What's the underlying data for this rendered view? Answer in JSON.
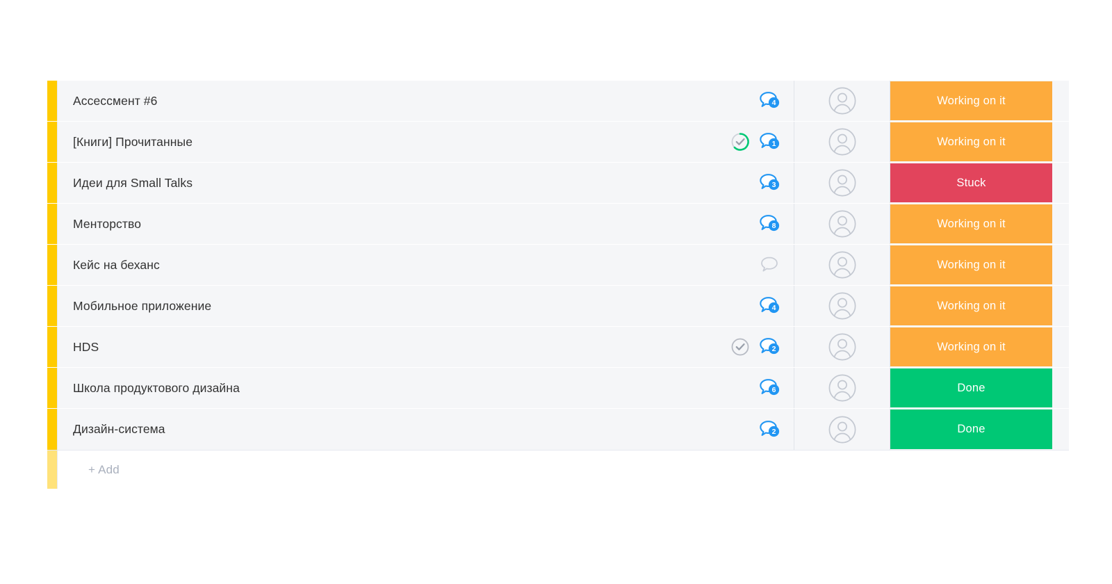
{
  "board": {
    "accent_color": "#ffcb00",
    "add_row": {
      "label": "+ Add",
      "bar_color": "#ffe27a"
    },
    "status_colors": {
      "working": "#fdab3d",
      "stuck": "#e2445c",
      "done": "#00c875"
    },
    "icon_colors": {
      "chat_blue": "#2196f3",
      "chat_empty_gray": "#c9cdd6",
      "check_green": "#00c875",
      "check_gray": "#9aa0ab",
      "avatar_gray": "#c3c8d1"
    },
    "rows": [
      {
        "name": "Ассессмент #6",
        "check": "none",
        "chat_icon": "chat-bubble-icon",
        "chat_count": "4",
        "person_icon": "avatar-placeholder-icon",
        "status": "Working on it",
        "status_key": "working"
      },
      {
        "name": "[Книги] Прочитанные",
        "check": "green",
        "check_icon": "check-circle-progress-icon",
        "chat_icon": "chat-bubble-icon",
        "chat_count": "1",
        "person_icon": "avatar-placeholder-icon",
        "status": "Working on it",
        "status_key": "working"
      },
      {
        "name": "Идеи для Small Talks",
        "check": "none",
        "chat_icon": "chat-bubble-icon",
        "chat_count": "3",
        "person_icon": "avatar-placeholder-icon",
        "status": "Stuck",
        "status_key": "stuck"
      },
      {
        "name": "Менторство",
        "check": "none",
        "chat_icon": "chat-bubble-icon",
        "chat_count": "8",
        "person_icon": "avatar-placeholder-icon",
        "status": "Working on it",
        "status_key": "working"
      },
      {
        "name": "Кейс на беханс",
        "check": "none",
        "chat_icon": "chat-bubble-empty-icon",
        "chat_count": "",
        "person_icon": "avatar-placeholder-icon",
        "status": "Working on it",
        "status_key": "working"
      },
      {
        "name": "Мобильное приложение",
        "check": "none",
        "chat_icon": "chat-bubble-icon",
        "chat_count": "4",
        "person_icon": "avatar-placeholder-icon",
        "status": "Working on it",
        "status_key": "working"
      },
      {
        "name": "HDS",
        "check": "gray",
        "check_icon": "check-circle-icon",
        "chat_icon": "chat-bubble-icon",
        "chat_count": "2",
        "person_icon": "avatar-placeholder-icon",
        "status": "Working on it",
        "status_key": "working"
      },
      {
        "name": "Школа продуктового дизайна",
        "check": "none",
        "chat_icon": "chat-bubble-icon",
        "chat_count": "6",
        "person_icon": "avatar-placeholder-icon",
        "status": "Done",
        "status_key": "done"
      },
      {
        "name": "Дизайн-система",
        "check": "none",
        "chat_icon": "chat-bubble-icon",
        "chat_count": "2",
        "person_icon": "avatar-placeholder-icon",
        "status": "Done",
        "status_key": "done"
      }
    ]
  }
}
